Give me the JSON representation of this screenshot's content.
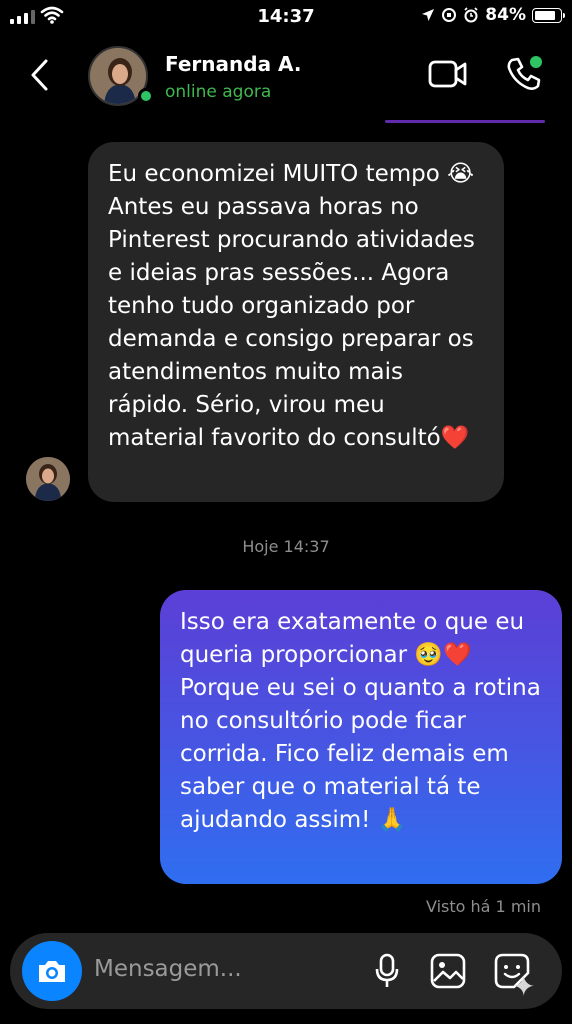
{
  "status_bar": {
    "time": "14:37",
    "battery": "84%",
    "battery_level": 0.84
  },
  "header": {
    "name": "Fernanda A.",
    "status": "online agora",
    "accent_online": "#2fc463"
  },
  "messages": {
    "incoming_text": "Eu economizei MUITO tempo 😭 Antes eu passava horas no Pinterest procurando atividades e ideias pras sessões... Agora tenho tudo organizado por demanda e consigo preparar os atendimentos muito mais rápido. Sério, virou meu material favorito do consultó❤️",
    "timestamp": "Hoje 14:37",
    "outgoing_text": "Isso era exatamente o que eu queria proporcionar 🥹❤️ Porque eu sei o quanto a rotina no consultório pode ficar corrida. Fico feliz demais em saber que o material tá te ajudando assim! 🙏",
    "seen": "Visto há 1 min"
  },
  "composer": {
    "placeholder": "Mensagem..."
  },
  "icons": {
    "back": "chevron-left-icon",
    "video": "video-camera-icon",
    "call": "phone-icon",
    "camera": "camera-icon",
    "mic": "microphone-icon",
    "gallery": "image-icon",
    "sticker": "sticker-icon"
  },
  "colors": {
    "bubble_in": "#262626",
    "bubble_out_top": "#5b3fd6",
    "bubble_out_bottom": "#2f6ef0",
    "camera_button": "#0a84ff"
  }
}
